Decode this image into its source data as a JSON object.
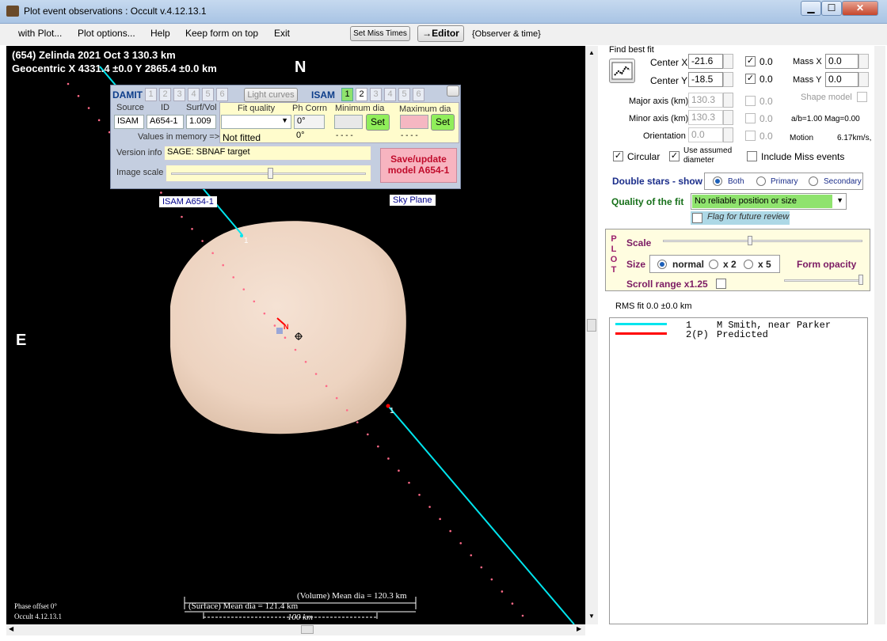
{
  "window": {
    "title": "Plot event observations : Occult v.4.12.13.1",
    "minimize": "▁",
    "maximize": "☐",
    "close": "✕"
  },
  "menu": {
    "with_plot": "with Plot...",
    "plot_options": "Plot options...",
    "help": "Help",
    "keep_on_top": "Keep form on top",
    "exit": "Exit",
    "set_miss_times": "Set Miss Times",
    "editor": "→Editor",
    "observer_time": "{Observer & time}"
  },
  "plot": {
    "header_line1": "(654) Zelinda  2021 Oct 3   130.3 km",
    "header_line2": "Geocentric  X  4331.4 ±0.0  Y 2865.4 ±0.0 km",
    "north": "N",
    "east": "E",
    "isam_label": "ISAM A654-1",
    "sky_plane": "Sky Plane",
    "chord1_label": "1",
    "chord2_label": "1",
    "center_n": "N",
    "volume_dia": "(Volume) Mean dia = 120.3 km",
    "surface_dia": "(Surface) Mean dia = 121.4 km",
    "scale_bar": "100 km",
    "phase_offset": "Phase offset 0°",
    "version": "Occult 4.12.13.1"
  },
  "model_panel": {
    "damit": "DAMIT",
    "damit_nums": [
      "1",
      "2",
      "3",
      "4",
      "5",
      "6"
    ],
    "light_curves": "Light curves",
    "isam": "ISAM",
    "isam_nums": [
      "1",
      "2",
      "3",
      "4",
      "5",
      "6"
    ],
    "hdr_source": "Source",
    "hdr_id": "ID",
    "hdr_surf": "Surf/Vol",
    "hdr_fit_quality": "Fit quality",
    "hdr_ph_corrn": "Ph Corrn",
    "hdr_min_dia": "Minimum dia",
    "hdr_max_dia": "Maximum dia",
    "source": "ISAM",
    "id": "A654-1",
    "surf_vol": "1.009",
    "ph_corrn_value": "0°",
    "set": "Set",
    "values_in_memory": "Values in memory =>",
    "not_fitted": "Not fitted",
    "mem_ph": "0°",
    "mem_min": "- - - -",
    "mem_max": "- - - -",
    "version_info_label": "Version info",
    "version_info": "SAGE: SBNAF target",
    "image_scale_label": "Image scale",
    "save_update_1": "Save/update",
    "save_update_2": "model A654-1"
  },
  "fit": {
    "find_best_fit": "Find best fit",
    "center_x_label": "Center X",
    "center_x": "-21.6",
    "center_y_label": "Center Y",
    "center_y": "-18.5",
    "cx_uncert": "0.0",
    "cy_uncert": "0.0",
    "mass_x_label": "Mass X",
    "mass_x": "0.0",
    "mass_y_label": "Mass Y",
    "mass_y": "0.0",
    "major_label": "Major axis (km)",
    "major": "130.3",
    "major_uncert": "0.0",
    "minor_label": "Minor axis (km)",
    "minor": "130.3",
    "minor_uncert": "0.0",
    "orient_label": "Orientation",
    "orient": "0.0",
    "orient_uncert": "0.0",
    "shape_model": "Shape model",
    "ab_mag": "a/b=1.00  Mag=0.00",
    "motion_label": "Motion",
    "motion": "6.17km/s,",
    "circular": "Circular",
    "use_assumed_1": "Use assumed",
    "use_assumed_2": "diameter",
    "include_miss": "Include Miss events",
    "double_stars": "Double stars - show",
    "both": "Both",
    "primary": "Primary",
    "secondary": "Secondary",
    "quality_label": "Quality of the fit",
    "quality_value": "No reliable position or size",
    "flag_review": "Flag for future review"
  },
  "plot_opts": {
    "plot_letters": [
      "P",
      "L",
      "O",
      "T"
    ],
    "scale": "Scale",
    "size": "Size",
    "normal": "normal",
    "x2": "x 2",
    "x5": "x 5",
    "form_opacity": "Form opacity",
    "scroll_range": "Scroll range x1.25"
  },
  "rms": "RMS fit 0.0 ±0.0 km",
  "legend": [
    {
      "num": "1",
      "text": "M Smith, near Parker",
      "color": "#00e5ee"
    },
    {
      "num": "2(P)",
      "text": "Predicted",
      "color": "#ff0000"
    }
  ],
  "colors": {
    "chord": "#00e5ee",
    "predicted": "#ff0000",
    "asteroid": "#f1d8c6",
    "dots": "#ff6a88",
    "panel_bg": "#c4cee0"
  }
}
